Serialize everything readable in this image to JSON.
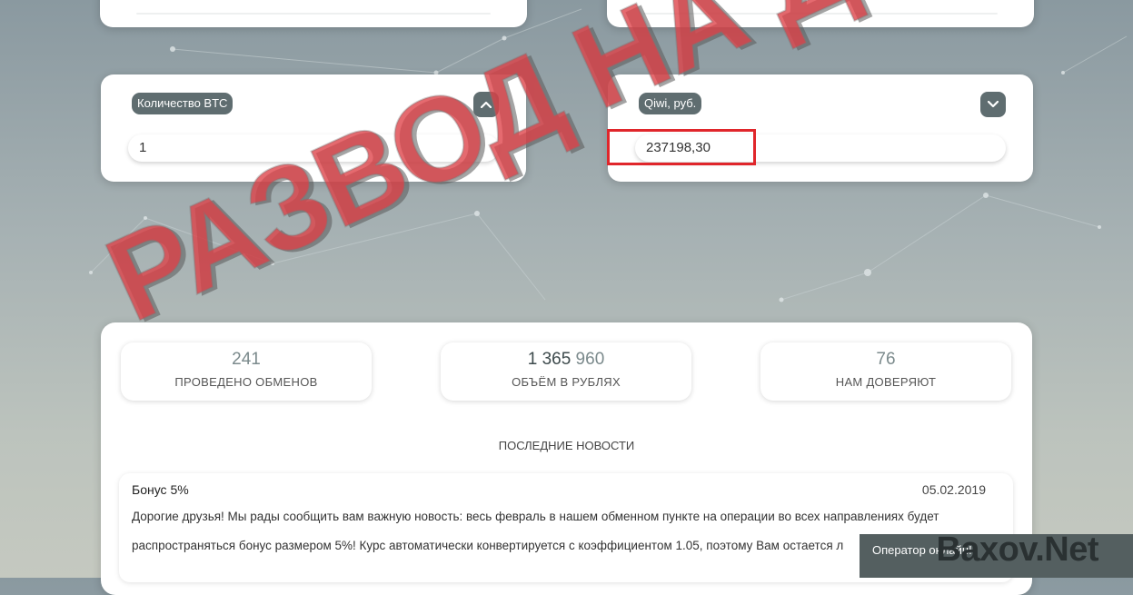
{
  "calculator": {
    "from": {
      "label": "Количество BTC",
      "value": "1"
    },
    "to": {
      "label": "Qiwi, руб.",
      "value": "237198,30"
    }
  },
  "stats": [
    {
      "number": "241",
      "label": "ПРОВЕДЕНО ОБМЕНОВ"
    },
    {
      "number_main": "1 365",
      "number_tail": " 960",
      "label": "ОБЪЁМ В РУБЛЯХ"
    },
    {
      "number": "76",
      "label": "НАМ ДОВЕРЯЮТ"
    }
  ],
  "news": {
    "section_title": "ПОСЛЕДНИЕ НОВОСТИ",
    "items": [
      {
        "title": "Бонус 5%",
        "date": "05.02.2019",
        "line1": "Дорогие друзья! Мы рады сообщить вам важную новость: весь февраль в нашем обменном пункте на операции во всех направлениях будет",
        "line2": "распространяться бонус размером 5%! Курс автоматически конвертируется с коэффициентом 1.05, поэтому Вам остается л"
      }
    ]
  },
  "operator": {
    "label": "Оператор онлайн!"
  },
  "watermark": {
    "text": "РАЗВОД НА ДЕНЬГИ",
    "site": "Baxov.Net"
  },
  "colors": {
    "accent_dark": "#5f6d70",
    "highlight_red": "#e0262b",
    "watermark_red": "#de4046"
  }
}
